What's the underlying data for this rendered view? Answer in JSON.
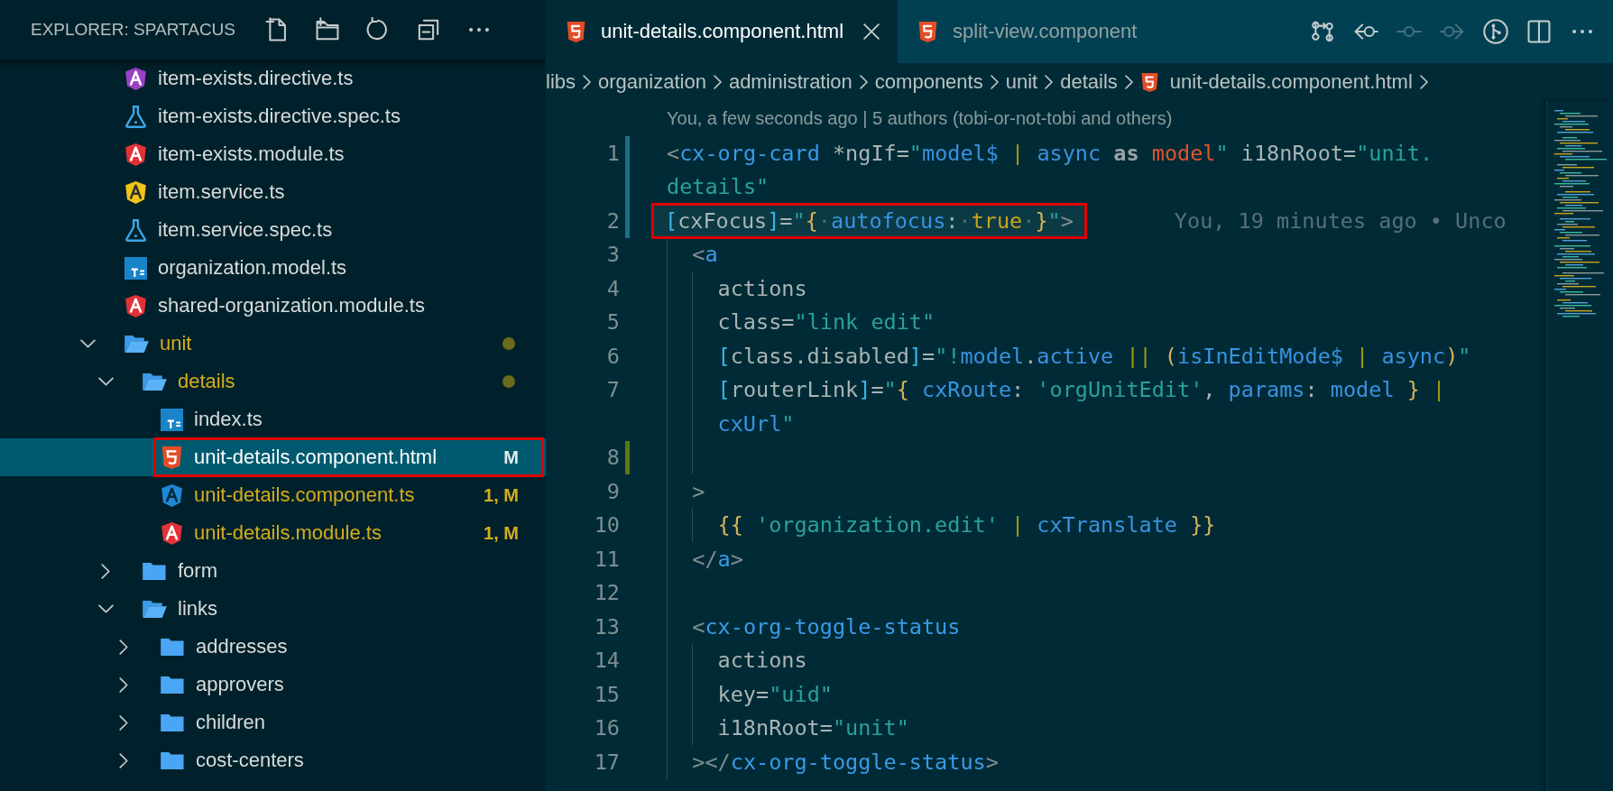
{
  "sidebar": {
    "title": "EXPLORER: SPARTACUS",
    "actions": [
      {
        "kind": "new-file"
      },
      {
        "kind": "new-folder"
      },
      {
        "kind": "refresh"
      },
      {
        "kind": "collapse"
      },
      {
        "kind": "more"
      }
    ],
    "tree": [
      {
        "kind": "directive",
        "label": "item-exists.directive.ts",
        "selected": false,
        "modified": false,
        "highlighted": false
      },
      {
        "kind": "spec",
        "label": "item-exists.directive.spec.ts",
        "selected": false,
        "modified": false,
        "highlighted": false
      },
      {
        "kind": "module",
        "label": "item-exists.module.ts",
        "selected": false,
        "modified": false,
        "highlighted": false
      },
      {
        "kind": "service",
        "label": "item.service.ts",
        "selected": false,
        "modified": false,
        "highlighted": false
      },
      {
        "kind": "spec",
        "label": "item.service.spec.ts",
        "selected": false,
        "modified": false,
        "highlighted": false
      },
      {
        "kind": "ts",
        "label": "organization.model.ts",
        "selected": false,
        "modified": false,
        "highlighted": false
      },
      {
        "kind": "module",
        "label": "shared-organization.module.ts",
        "selected": false,
        "modified": false,
        "highlighted": false
      },
      {
        "kind": "folder",
        "label": "unit",
        "expanded": true,
        "selected": false,
        "modified": true,
        "highlighted": false,
        "children": [
          {
            "kind": "folder",
            "label": "details",
            "expanded": true,
            "selected": false,
            "modified": true,
            "highlighted": false,
            "children": [
              {
                "kind": "ts",
                "label": "index.ts",
                "selected": false,
                "modified": false,
                "highlighted": false
              },
              {
                "kind": "html",
                "label": "unit-details.component.html",
                "selected": true,
                "modified": true,
                "badge": "M",
                "highlighted": true
              },
              {
                "kind": "component",
                "label": "unit-details.component.ts",
                "selected": false,
                "modified": true,
                "badge": "1, M",
                "highlighted": false
              },
              {
                "kind": "module",
                "label": "unit-details.module.ts",
                "selected": false,
                "modified": true,
                "badge": "1, M",
                "highlighted": false
              }
            ]
          },
          {
            "kind": "folder",
            "label": "form",
            "expanded": false,
            "selected": false,
            "modified": false,
            "highlighted": false
          },
          {
            "kind": "folder",
            "label": "links",
            "expanded": true,
            "selected": false,
            "modified": false,
            "highlighted": false,
            "children": [
              {
                "kind": "folder",
                "label": "addresses",
                "expanded": false,
                "selected": false,
                "modified": false,
                "highlighted": false
              },
              {
                "kind": "folder",
                "label": "approvers",
                "expanded": false,
                "selected": false,
                "modified": false,
                "highlighted": false
              },
              {
                "kind": "folder",
                "label": "children",
                "expanded": false,
                "selected": false,
                "modified": false,
                "highlighted": false
              },
              {
                "kind": "folder",
                "label": "cost-centers",
                "expanded": false,
                "selected": false,
                "modified": false,
                "highlighted": false
              }
            ]
          }
        ]
      }
    ]
  },
  "editor": {
    "tabs": [
      {
        "label": "unit-details.component.html",
        "kind": "html",
        "selected": true
      },
      {
        "label": "split-view.component",
        "kind": "html",
        "selected": false
      }
    ],
    "actions": [
      {
        "kind": "compare",
        "disabled": false
      },
      {
        "kind": "previous-change",
        "disabled": false
      },
      {
        "kind": "commit",
        "disabled": true
      },
      {
        "kind": "next-change",
        "disabled": true
      },
      {
        "kind": "git-graph",
        "disabled": false
      },
      {
        "kind": "split",
        "disabled": false
      },
      {
        "kind": "more",
        "disabled": false
      }
    ],
    "breadcrumbs": [
      {
        "label": "libs",
        "kind": "folder"
      },
      {
        "label": "organization",
        "kind": "folder"
      },
      {
        "label": "administration",
        "kind": "folder"
      },
      {
        "label": "components",
        "kind": "folder"
      },
      {
        "label": "unit",
        "kind": "folder"
      },
      {
        "label": "details",
        "kind": "folder"
      },
      {
        "label": "unit-details.component.html",
        "kind": "html"
      }
    ],
    "codelens": "You, a few seconds ago | 5 authors (tobi-or-not-tobi and others)",
    "lines": [
      {
        "number": "1",
        "kind": "modified",
        "highlighted": false,
        "text": "<cx-org-card *ngIf=\"model$ | async as model\" i18nRoot=\"unit.",
        "continuation": "details\""
      },
      {
        "number": "2",
        "kind": "modified",
        "highlighted": true,
        "text": "[cxFocus]=\"{·autofocus:·true·}\">",
        "blame": "You, 19 minutes ago • Unco"
      },
      {
        "number": "3",
        "kind": "plain",
        "highlighted": false,
        "text": "  <a"
      },
      {
        "number": "4",
        "kind": "plain",
        "highlighted": false,
        "text": "    actions"
      },
      {
        "number": "5",
        "kind": "plain",
        "highlighted": false,
        "text": "    class=\"link edit\""
      },
      {
        "number": "6",
        "kind": "plain",
        "highlighted": false,
        "text": "    [class.disabled]=\"!model.active || (isInEditMode$ | async)\""
      },
      {
        "number": "7",
        "kind": "plain",
        "highlighted": false,
        "text": "    [routerLink]=\"{ cxRoute: 'orgUnitEdit', params: model } |",
        "continuation": "    cxUrl\""
      },
      {
        "number": "8",
        "kind": "added",
        "highlighted": false
      },
      {
        "number": "9",
        "kind": "plain",
        "highlighted": false,
        "text": "  >"
      },
      {
        "number": "10",
        "kind": "plain",
        "highlighted": false,
        "text": "    {{ 'organization.edit' | cxTranslate }}"
      },
      {
        "number": "11",
        "kind": "plain",
        "highlighted": false,
        "text": "  </a>"
      },
      {
        "number": "12",
        "kind": "plain",
        "highlighted": false
      },
      {
        "number": "13",
        "kind": "plain",
        "highlighted": false,
        "text": "  <cx-org-toggle-status"
      },
      {
        "number": "14",
        "kind": "plain",
        "highlighted": false,
        "text": "    actions"
      },
      {
        "number": "15",
        "kind": "plain",
        "highlighted": false,
        "text": "    key=\"uid\""
      },
      {
        "number": "16",
        "kind": "plain",
        "highlighted": false,
        "text": "    i18nRoot=\"unit\""
      },
      {
        "number": "17",
        "kind": "plain",
        "highlighted": false,
        "text": "  ></cx-org-toggle-status>"
      }
    ]
  }
}
